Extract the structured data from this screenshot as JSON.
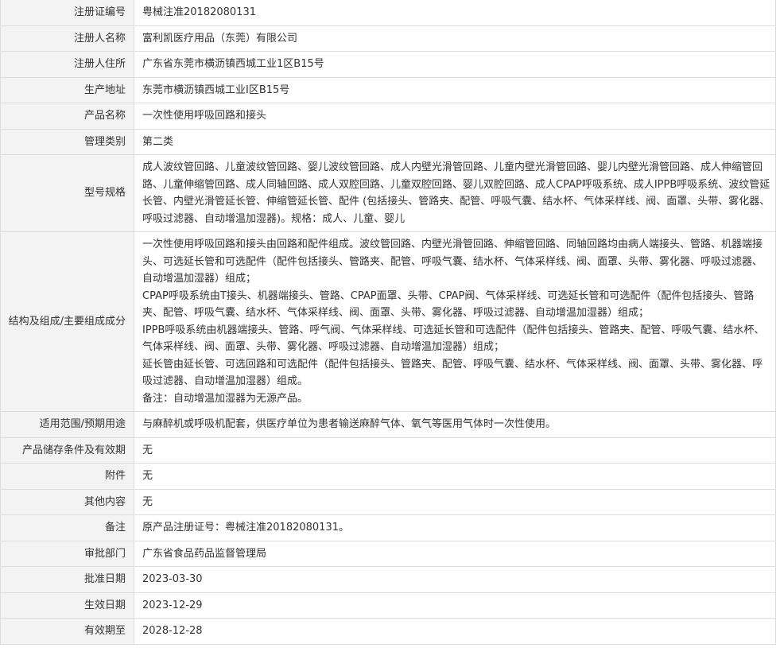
{
  "rows": [
    {
      "label": "注册证编号",
      "value": "粤械注准20182080131"
    },
    {
      "label": "注册人名称",
      "value": "富利凯医疗用品（东莞）有限公司"
    },
    {
      "label": "注册人住所",
      "value": "广东省东莞市横沥镇西城工业1区B15号"
    },
    {
      "label": "生产地址",
      "value": "东莞市横沥镇西城工业I区B15号"
    },
    {
      "label": "产品名称",
      "value": "一次性使用呼吸回路和接头"
    },
    {
      "label": "管理类别",
      "value": "第二类"
    },
    {
      "label": "型号规格",
      "value": "成人波纹管回路、儿童波纹管回路、婴儿波纹管回路、成人内壁光滑管回路、儿童内壁光滑管回路、婴儿内壁光滑管回路、成人伸缩管回路、儿童伸缩管回路、成人同轴回路、成人双腔回路、儿童双腔回路、婴儿双腔回路、成人CPAP呼吸系统、成人IPPB呼吸系统、波纹管延长管、内壁光滑管延长管、伸缩管延长管、配件 (包括接头、管路夹、配管、呼吸气囊、结水杯、气体采样线、阀、面罩、头带、雾化器、呼吸过滤器、自动增温加湿器)。规格：成人、儿童、婴儿"
    },
    {
      "label": "结构及组成/主要组成成分",
      "paragraphs": [
        "一次性使用呼吸回路和接头由回路和配件组成。波纹管回路、内壁光滑管回路、伸缩管回路、同轴回路均由病人端接头、管路、机器端接头、可选延长管和可选配件（配件包括接头、管路夹、配管、呼吸气囊、结水杯、气体采样线、阀、面罩、头带、雾化器、呼吸过滤器、自动增温加湿器）组成；",
        "CPAP呼吸系统由T接头、机器端接头、管路、CPAP面罩、头带、CPAP阀、气体采样线、可选延长管和可选配件（配件包括接头、管路夹、配管、呼吸气囊、结水杯、气体采样线、阀、面罩、头带、雾化器、呼吸过滤器、自动增温加湿器）组成；",
        "IPPB呼吸系统由机器端接头、管路、呼气阀、气体采样线、可选延长管和可选配件（配件包括接头、管路夹、配管、呼吸气囊、结水杯、气体采样线、阀、面罩、头带、雾化器、呼吸过滤器、自动增温加湿器）组成；",
        "延长管由延长管、可选回路和可选配件（配件包括接头、管路夹、配管、呼吸气囊、结水杯、气体采样线、阀、面罩、头带、雾化器、呼吸过滤器、自动增温加湿器）组成。",
        "备注：自动增温加湿器为无源产品。"
      ]
    },
    {
      "label": "适用范围/预期用途",
      "value": "与麻醉机或呼吸机配套，供医疗单位为患者输送麻醉气体、氧气等医用气体时一次性使用。"
    },
    {
      "label": "产品储存条件及有效期",
      "value": "无"
    },
    {
      "label": "附件",
      "value": "无"
    },
    {
      "label": "其他内容",
      "value": "无"
    },
    {
      "label": "备注",
      "value": "原产品注册证号：粤械注准20182080131。"
    },
    {
      "label": "审批部门",
      "value": "广东省食品药品监督管理局"
    },
    {
      "label": "批准日期",
      "value": "2023-03-30"
    },
    {
      "label": "生效日期",
      "value": "2023-12-29"
    },
    {
      "label": "有效期至",
      "value": "2028-12-28"
    }
  ]
}
